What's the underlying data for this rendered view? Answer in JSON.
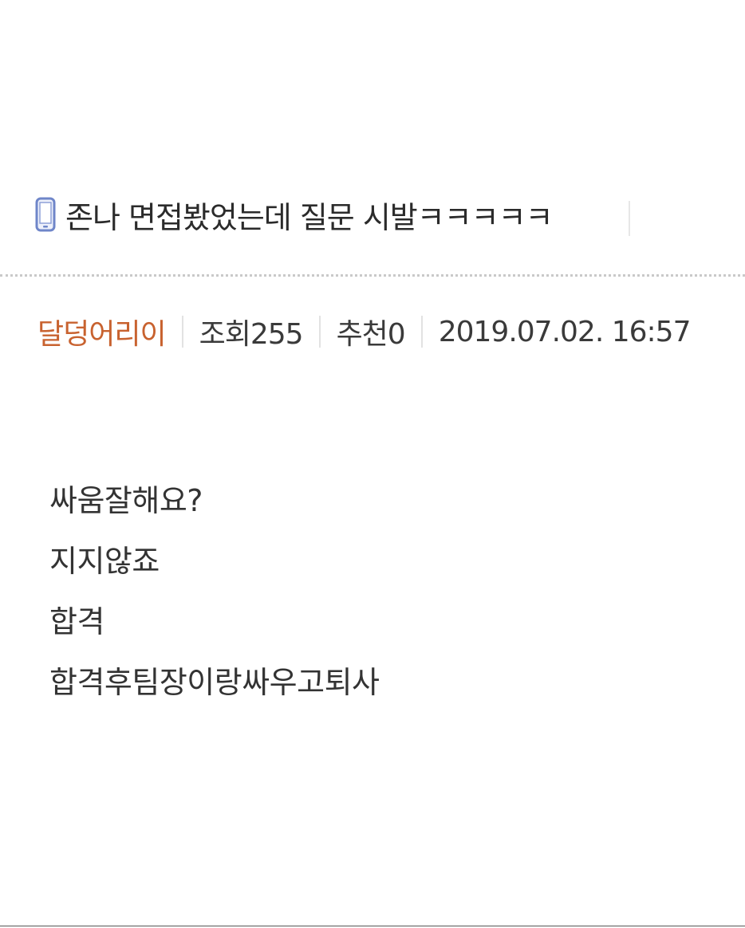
{
  "post": {
    "title": "존나 면접봤었는데 질문 시발ㅋㅋㅋㅋㅋ",
    "title_icon": "mobile-phone-icon",
    "meta": {
      "author": "달덩어리이",
      "views": "조회255",
      "recommend": "추천0",
      "datetime": "2019.07.02. 16:57"
    },
    "body_lines": [
      "싸움잘해요?",
      "지지않죠",
      "합격",
      "합격후팀장이랑싸우고퇴사"
    ]
  },
  "colors": {
    "author": "#c8622f",
    "icon": "#6f86c9",
    "text": "#333333"
  }
}
